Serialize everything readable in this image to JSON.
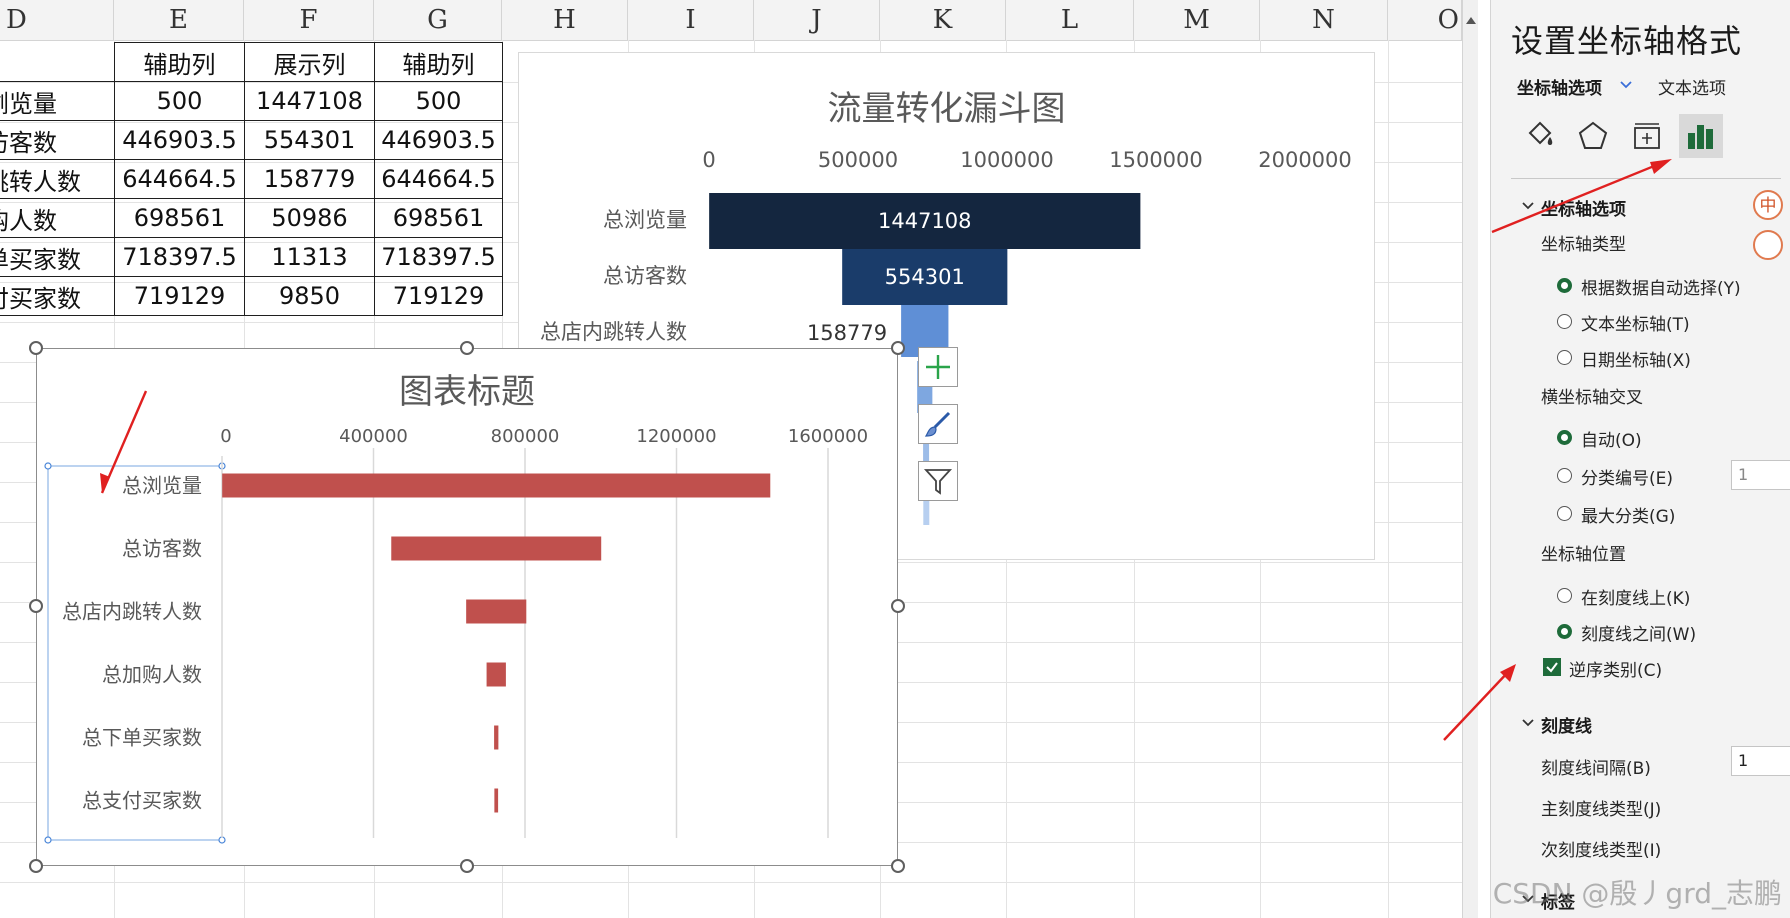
{
  "columns": [
    "D",
    "E",
    "F",
    "G",
    "H",
    "I",
    "J",
    "K",
    "L",
    "M",
    "N",
    "O"
  ],
  "table": {
    "headers": [
      "",
      "辅助列",
      "展示列",
      "辅助列"
    ],
    "rows": [
      [
        "浏览量",
        "500",
        "1447108",
        "500"
      ],
      [
        "访客数",
        "446903.5",
        "554301",
        "446903.5"
      ],
      [
        "跳转人数",
        "644664.5",
        "158779",
        "644664.5"
      ],
      [
        "购人数",
        "698561",
        "50986",
        "698561"
      ],
      [
        "单买家数",
        "718397.5",
        "11313",
        "718397.5"
      ],
      [
        "付买家数",
        "719129",
        "9850",
        "719129"
      ]
    ]
  },
  "funnel_chart": {
    "title": "流量转化漏斗图",
    "axis_ticks": [
      "0",
      "500000",
      "1000000",
      "1500000",
      "2000000"
    ],
    "categories": [
      "总浏览量",
      "总访客数",
      "总店内跳转人数"
    ],
    "offsets": [
      500,
      446903.5,
      644664.5,
      698561,
      718397.5,
      719129
    ],
    "values": [
      1447108,
      554301,
      158779,
      50986,
      11313,
      9850
    ],
    "value_labels": [
      "1447108",
      "554301",
      "158779"
    ],
    "colors": [
      "#14263f",
      "#1a3c6a",
      "#5f8fd6",
      "#7ea7e0",
      "#9cbce8",
      "#b7cff0"
    ]
  },
  "chart_data": {
    "type": "bar",
    "title": "图表标题",
    "categories": [
      "总浏览量",
      "总访客数",
      "总店内跳转人数",
      "总加购人数",
      "总下单买家数",
      "总支付买家数"
    ],
    "series": [
      {
        "values": [
          500,
          446903.5,
          644664.5,
          698561,
          718397.5,
          719129
        ],
        "color": "transparent"
      },
      {
        "values": [
          1447108,
          554301,
          158779,
          50986,
          11313,
          9850
        ],
        "color": "#c0504d"
      }
    ],
    "stacked": true,
    "orientation": "horizontal",
    "xlim": [
      0,
      1600000
    ],
    "x_ticks": [
      "0",
      "400000",
      "800000",
      "1200000",
      "1600000"
    ],
    "grid": true
  },
  "chart_buttons": [
    "chart-elements-plus",
    "chart-styles-brush",
    "chart-filters-funnel"
  ],
  "panel": {
    "title": "设置坐标轴格式",
    "tab_axis": "坐标轴选项",
    "tab_text": "文本选项",
    "icons": [
      "fill-line-icon",
      "effects-pentagon-icon",
      "size-properties-icon",
      "axis-options-bar-icon"
    ],
    "sections": {
      "axis_options": "坐标轴选项",
      "axis_type": "坐标轴类型",
      "axis_type_options": [
        "根据数据自动选择(Y)",
        "文本坐标轴(T)",
        "日期坐标轴(X)"
      ],
      "axis_type_selected": 0,
      "cross": "横坐标轴交叉",
      "cross_options": [
        "自动(O)",
        "分类编号(E)",
        "最大分类(G)"
      ],
      "cross_selected": 0,
      "cross_number": "1",
      "position": "坐标轴位置",
      "position_options": [
        "在刻度线上(K)",
        "刻度线之间(W)"
      ],
      "position_selected": 1,
      "reverse": "逆序类别(C)",
      "reverse_checked": true,
      "tick_marks": "刻度线",
      "tick_interval": "刻度线间隔(B)",
      "tick_interval_value": "1",
      "major_tick": "主刻度线类型(J)",
      "minor_tick": "次刻度线类型(I)",
      "labels": "标签"
    },
    "badges": [
      "中"
    ]
  },
  "watermark": "CSDN @殷丿grd_志鹏",
  "colors": {
    "accent_green": "#1e6b3a",
    "arrow_red": "#e02020",
    "bar_red": "#c0504d"
  }
}
